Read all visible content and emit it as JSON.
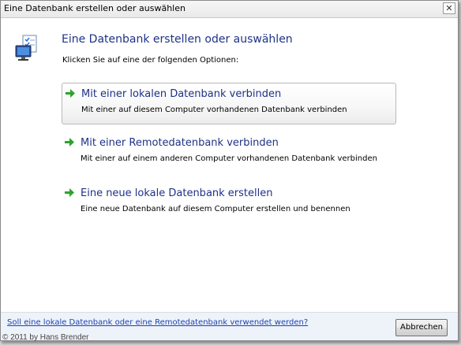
{
  "window": {
    "title": "Eine Datenbank erstellen oder auswählen",
    "close_label": "✕"
  },
  "main": {
    "heading": "Eine Datenbank erstellen oder auswählen",
    "instruction": "Klicken Sie auf eine der folgenden Optionen:",
    "options": [
      {
        "title": "Mit einer lokalen Datenbank verbinden",
        "description": "Mit einer auf diesem Computer vorhandenen Datenbank verbinden",
        "icon": "green-arrow-icon"
      },
      {
        "title": "Mit einer Remotedatenbank verbinden",
        "description": "Mit einer auf einem anderen Computer vorhandenen Datenbank verbinden",
        "icon": "green-arrow-icon"
      },
      {
        "title": "Eine neue lokale Datenbank erstellen",
        "description": "Eine neue Datenbank auf diesem Computer erstellen und benennen",
        "icon": "green-arrow-icon"
      }
    ]
  },
  "footer": {
    "help_link": "Soll eine lokale Datenbank oder eine Remotedatenbank verwendet werden?",
    "cancel_label": "Abbrechen"
  },
  "watermark": "© 2011 by Hans Brender",
  "colors": {
    "heading": "#1e3287",
    "link": "#1b43b1",
    "arrow": "#2aa52a",
    "footer_bg": "#eef3fa"
  }
}
